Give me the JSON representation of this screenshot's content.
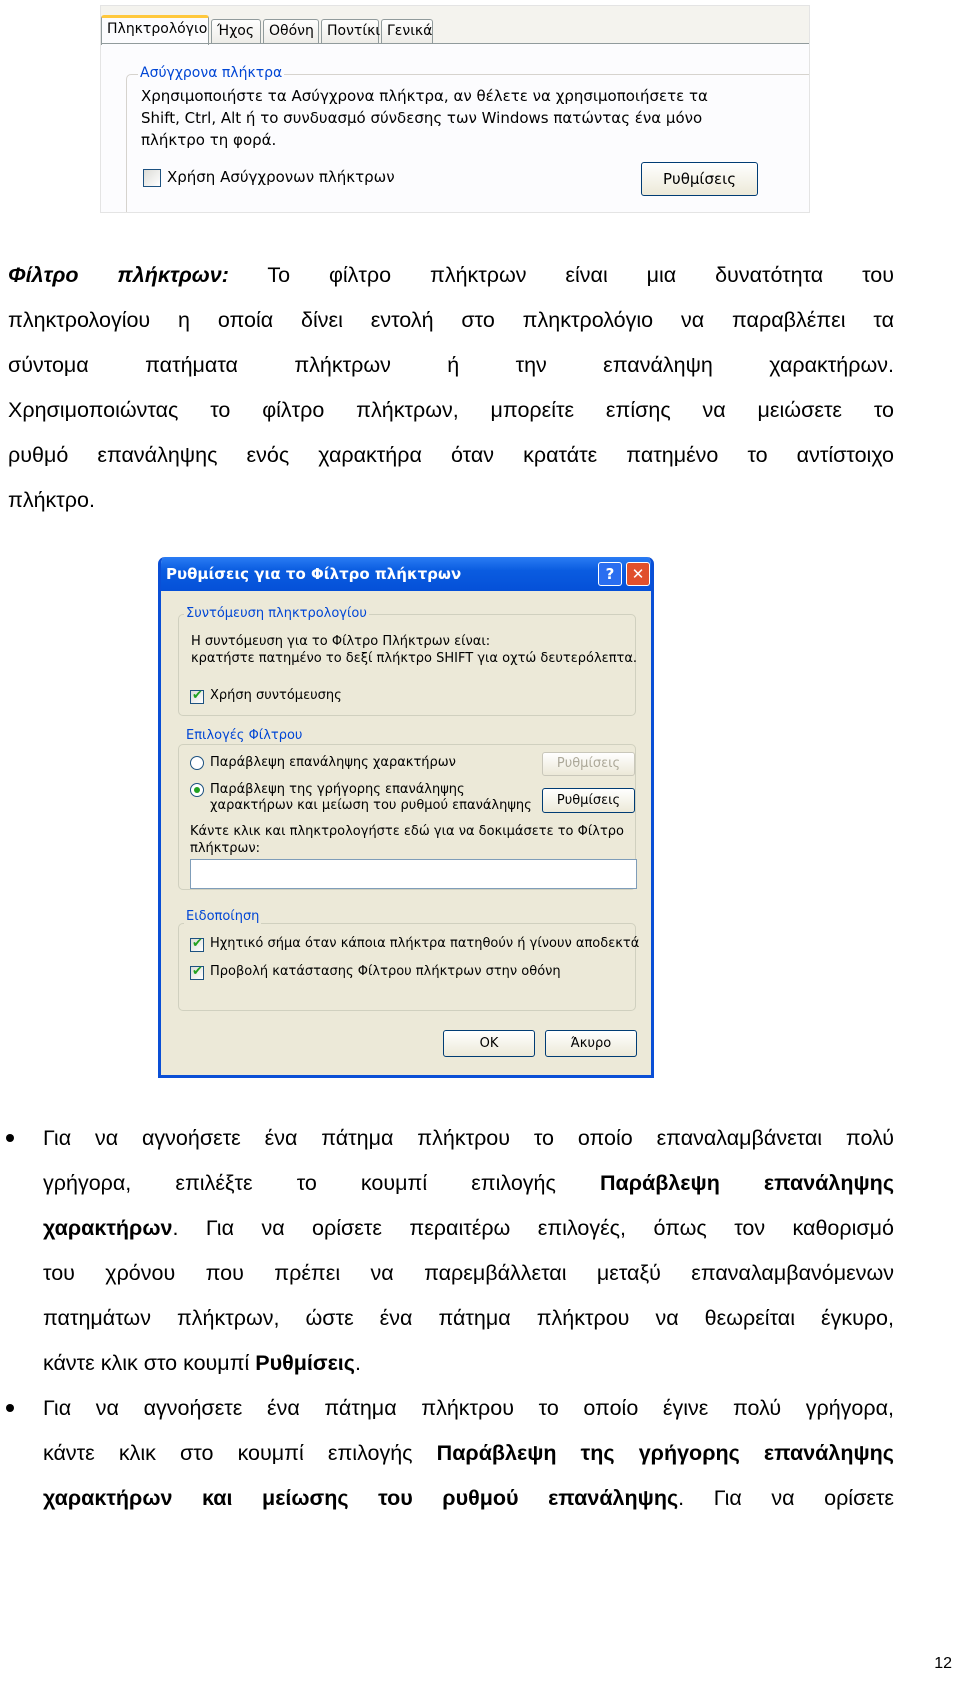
{
  "accessibility_tab_screenshot": {
    "tabs": [
      "Πληκτρολόγιο",
      "Ήχος",
      "Οθόνη",
      "Ποντίκι",
      "Γενικά"
    ],
    "group_title": "Ασύγχρονα πλήκτρα",
    "description_lines": [
      "Χρησιμοποιήστε τα Ασύγχρονα πλήκτρα, αν θέλετε να χρησιμοποιήσετε τα",
      "Shift, Ctrl, Alt ή το συνδυασμό σύνδεσης των Windows πατώντας ένα μόνο",
      "πλήκτρο τη φορά."
    ],
    "checkbox_label": "Χρήση Ασύγχρονων πλήκτρων",
    "checkbox_checked": false,
    "settings_button": "Ρυθμίσεις"
  },
  "paragraph1": {
    "term": "Φίλτρο πλήκτρων:",
    "lines": [
      " Το φίλτρο πλήκτρων είναι μια δυνατότητα του",
      "πληκτρολογίου η οποία δίνει εντολή στο πληκτρολόγιο να παραβλέπει τα",
      "σύντομα πατήματα πλήκτρων ή την επανάληψη χαρακτήρων.",
      "Χρησιμοποιώντας το φίλτρο πλήκτρων, μπορείτε επίσης να μειώσετε το",
      "ρυθμό επανάληψης ενός χαρακτήρα όταν κρατάτε πατημένο το αντίστοιχο",
      "πλήκτρο."
    ]
  },
  "dialog": {
    "title": "Ρυθμίσεις για το Φίλτρο πλήκτρων",
    "help_button": "?",
    "close_button": "✕",
    "shortcut_group": {
      "title": "Συντόμευση πληκτρολογίου",
      "text_lines": [
        "Η συντόμευση για το Φίλτρο Πλήκτρων είναι:",
        "κρατήστε πατημένο το δεξί πλήκτρο SHIFT για οχτώ δευτερόλεπτα."
      ],
      "use_shortcut_label": "Χρήση συντόμευσης",
      "use_shortcut_checked": true
    },
    "filter_group": {
      "title": "Επιλογές Φίλτρου",
      "option1": "Παράβλεψη επανάληψης χαρακτήρων",
      "option2_lines": [
        "Παράβλεψη της γρήγορης επανάληψης",
        "χαρακτήρων και μείωση του ρυθμού επανάληψης"
      ],
      "selected_option": 2,
      "settings1": "Ρυθμίσεις",
      "settings2": "Ρυθμίσεις",
      "test_label_lines": [
        "Κάντε κλικ και πληκτρολογήστε εδώ για να δοκιμάσετε το Φίλτρο",
        "πλήκτρων:"
      ],
      "test_input_value": ""
    },
    "notification_group": {
      "title": "Ειδοποίηση",
      "beep_label": "Ηχητικό σήμα όταν κάποια πλήκτρα πατηθούν ή γίνουν αποδεκτά",
      "beep_checked": true,
      "status_label": "Προβολή κατάστασης Φίλτρου πλήκτρων στην οθόνη",
      "status_checked": true
    },
    "ok_button": "OK",
    "cancel_button": "Άκυρο"
  },
  "bullet1": {
    "l1": "Για να αγνοήσετε ένα πάτημα πλήκτρου το οποίο επαναλαμβάνεται πολύ",
    "l2": "γρήγορα, επιλέξτε το κουμπί επιλογής ",
    "l2b": "Παράβλεψη επανάληψης",
    "l3b": "χαρακτήρων",
    "l3": ". Για να ορίσετε περαιτέρω επιλογές, όπως τον καθορισμό",
    "l4": "του χρόνου που πρέπει να παρεμβάλλεται μεταξύ επαναλαμβανόμενων",
    "l5": "πατημάτων πλήκτρων, ώστε ένα πάτημα πλήκτρου να θεωρείται έγκυρο,",
    "l6": "κάντε κλικ στο κουμπί ",
    "l6b": "Ρυθμίσεις",
    "l6e": "."
  },
  "bullet2": {
    "l1": "Για να αγνοήσετε ένα πάτημα πλήκτρου το οποίο έγινε πολύ γρήγορα,",
    "l2": "κάντε κλικ στο κουμπί επιλογής ",
    "l2b": "Παράβλεψη της γρήγορης επανάληψης",
    "l3b": "χαρακτήρων και μείωσης του ρυθμού επανάληψης",
    "l3": ". Για να ορίσετε"
  },
  "page_number": "12"
}
